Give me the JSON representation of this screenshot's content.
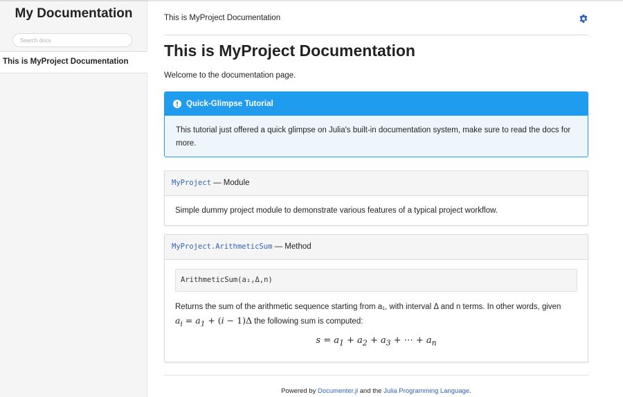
{
  "sidebar": {
    "site_title": "My Documentation",
    "search_placeholder": "Search docs",
    "current_page": "This is MyProject Documentation"
  },
  "header": {
    "breadcrumb": "This is MyProject Documentation",
    "settings_icon": "gear-icon"
  },
  "page": {
    "title": "This is MyProject Documentation",
    "intro": "Welcome to the documentation page."
  },
  "admonition": {
    "icon": "info-circle-icon",
    "title": "Quick-Glimpse Tutorial",
    "body": "This tutorial just offered a quick glimpse on Julia's built-in documentation system, make sure to read the docs for more."
  },
  "docstrings": [
    {
      "binding": "MyProject",
      "dash": " — ",
      "category": "Module",
      "body": "Simple dummy project module to demonstrate various features of a typical project workflow."
    },
    {
      "binding": "MyProject.ArithmeticSum",
      "dash": " — ",
      "category": "Method",
      "signature": "ArithmeticSum(a₁,Δ,n)",
      "text_line1": "Returns the sum of the arithmetic sequence starting from a₁, with interval Δ and n terms. In other words, given",
      "text_line2_suffix": " the following sum is computed:"
    }
  ],
  "footer": {
    "prefix": "Powered by ",
    "link1": "Documenter.jl",
    "middle": " and the ",
    "link2": "Julia Programming Language",
    "suffix": "."
  },
  "colors": {
    "accent": "#209cee",
    "link": "#2e63b8",
    "sidebar_bg": "#f5f5f5"
  }
}
